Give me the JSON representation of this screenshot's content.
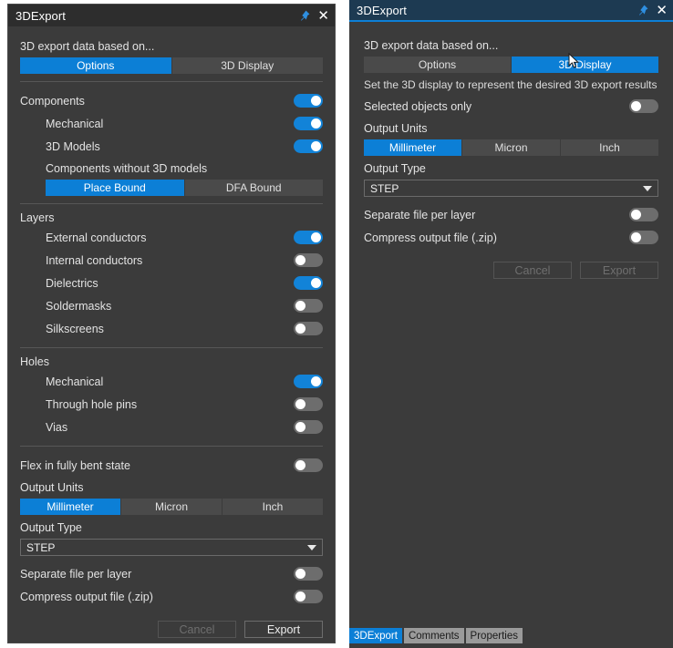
{
  "colors": {
    "accent": "#0c7fd6",
    "panel_bg": "#3b3b3b",
    "titlebar_active": "#1d3a52",
    "titlebar_inactive": "#2d2d2d",
    "toggle_on": "#1283d8",
    "toggle_off": "#6d6d6d"
  },
  "left_panel": {
    "title": "3DExport",
    "pin_icon": "pin-icon",
    "close_icon": "close-icon",
    "based_on_label": "3D export data based on...",
    "tabs": [
      {
        "label": "Options",
        "selected": true
      },
      {
        "label": "3D Display",
        "selected": false
      }
    ],
    "sections": {
      "components": {
        "header": "Components",
        "header_toggle": "on",
        "items": [
          {
            "label": "Mechanical",
            "toggle": "on"
          },
          {
            "label": "3D Models",
            "toggle": "on"
          }
        ],
        "sub_label": "Components without 3D models",
        "bound_segments": [
          {
            "label": "Place Bound",
            "selected": true
          },
          {
            "label": "DFA Bound",
            "selected": false
          }
        ]
      },
      "layers": {
        "header": "Layers",
        "items": [
          {
            "label": "External conductors",
            "toggle": "on"
          },
          {
            "label": "Internal conductors",
            "toggle": "off"
          },
          {
            "label": "Dielectrics",
            "toggle": "on"
          },
          {
            "label": "Soldermasks",
            "toggle": "off"
          },
          {
            "label": "Silkscreens",
            "toggle": "off"
          }
        ]
      },
      "holes": {
        "header": "Holes",
        "items": [
          {
            "label": "Mechanical",
            "toggle": "on"
          },
          {
            "label": "Through hole pins",
            "toggle": "off"
          },
          {
            "label": "Vias",
            "toggle": "off"
          }
        ]
      },
      "flex": {
        "label": "Flex in fully bent state",
        "toggle": "off"
      }
    },
    "output_units": {
      "label": "Output Units",
      "segments": [
        {
          "label": "Millimeter",
          "selected": true
        },
        {
          "label": "Micron",
          "selected": false
        },
        {
          "label": "Inch",
          "selected": false
        }
      ]
    },
    "output_type": {
      "label": "Output Type",
      "value": "STEP",
      "options": [
        "STEP"
      ]
    },
    "separate_file": {
      "label": "Separate file per layer",
      "toggle": "off"
    },
    "compress_file": {
      "label": "Compress output file (.zip)",
      "toggle": "off"
    },
    "buttons": {
      "cancel": {
        "label": "Cancel",
        "enabled": false
      },
      "export": {
        "label": "Export",
        "enabled": true
      }
    }
  },
  "right_panel": {
    "title": "3DExport",
    "pin_icon": "pin-icon",
    "close_icon": "close-icon",
    "based_on_label": "3D export data based on...",
    "tabs": [
      {
        "label": "Options",
        "selected": false
      },
      {
        "label": "3D Display",
        "selected": true
      }
    ],
    "help_text": "Set the 3D display to represent the desired 3D export results",
    "selected_objects_only": {
      "label": "Selected objects only",
      "toggle": "off"
    },
    "output_units": {
      "label": "Output Units",
      "segments": [
        {
          "label": "Millimeter",
          "selected": true
        },
        {
          "label": "Micron",
          "selected": false
        },
        {
          "label": "Inch",
          "selected": false
        }
      ]
    },
    "output_type": {
      "label": "Output Type",
      "value": "STEP",
      "options": [
        "STEP"
      ]
    },
    "separate_file": {
      "label": "Separate file per layer",
      "toggle": "off"
    },
    "compress_file": {
      "label": "Compress output file (.zip)",
      "toggle": "off"
    },
    "buttons": {
      "cancel": {
        "label": "Cancel",
        "enabled": false
      },
      "export": {
        "label": "Export",
        "enabled": false
      }
    }
  },
  "bottom_tabs": [
    {
      "label": "3DExport",
      "selected": true
    },
    {
      "label": "Comments",
      "selected": false
    },
    {
      "label": "Properties",
      "selected": false
    }
  ]
}
